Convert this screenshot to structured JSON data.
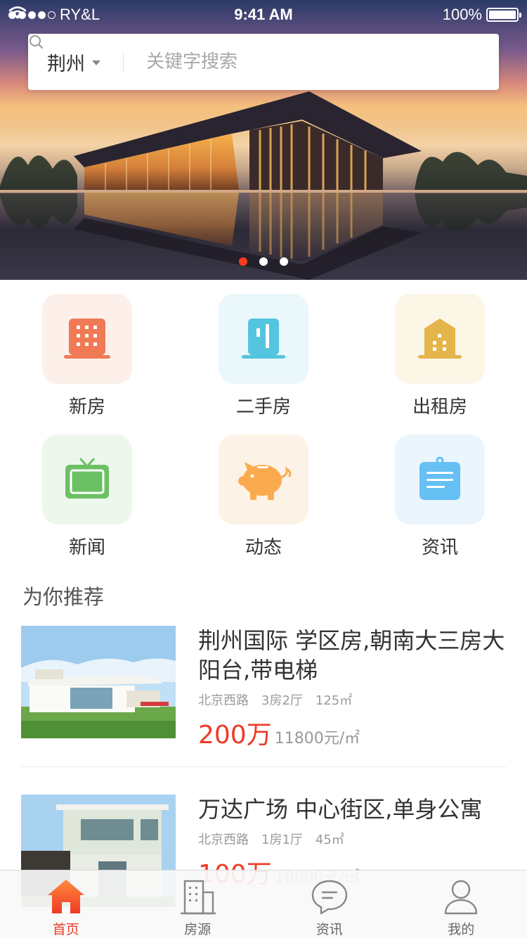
{
  "status_bar": {
    "carrier": "RY&L",
    "time": "9:41 AM",
    "battery": "100%"
  },
  "search": {
    "city": "荆州",
    "placeholder": "关键字搜索"
  },
  "banner": {
    "slide_count": 3,
    "active_slide": 1
  },
  "categories": [
    {
      "label": "新房",
      "icon": "building-icon",
      "color": "#f07a55",
      "bg": "#fdf0ea"
    },
    {
      "label": "二手房",
      "icon": "tower-icon",
      "color": "#55c4de",
      "bg": "#eaf7fb"
    },
    {
      "label": "出租房",
      "icon": "house-building-icon",
      "color": "#e4b54a",
      "bg": "#fcf6e6"
    },
    {
      "label": "新闻",
      "icon": "tv-icon",
      "color": "#6cc064",
      "bg": "#eef7ec"
    },
    {
      "label": "动态",
      "icon": "piggy-bank-icon",
      "color": "#fbab4e",
      "bg": "#fdf2e6"
    },
    {
      "label": "资讯",
      "icon": "notepad-icon",
      "color": "#66c0f4",
      "bg": "#eaf5fc"
    }
  ],
  "recommend": {
    "title": "为你推荐",
    "listings": [
      {
        "title": "荆州国际 学区房,朝南大三房大阳台,带电梯",
        "road": "北京西路",
        "layout": "3房2厅",
        "area": "125㎡",
        "price": "200万",
        "unit_price": "11800元/㎡"
      },
      {
        "title": "万达广场 中心街区,单身公寓",
        "road": "北京西路",
        "layout": "1房1厅",
        "area": "45㎡",
        "price": "100万",
        "unit_price": "18000元/㎡"
      }
    ]
  },
  "tabbar": {
    "tabs": [
      {
        "label": "首页",
        "icon": "home-icon",
        "active": true
      },
      {
        "label": "房源",
        "icon": "buildings-icon",
        "active": false
      },
      {
        "label": "资讯",
        "icon": "chat-bubble-icon",
        "active": false
      },
      {
        "label": "我的",
        "icon": "user-icon",
        "active": false
      }
    ]
  },
  "colors": {
    "accent": "#ee3a26",
    "muted_text": "#9a9a9a"
  }
}
